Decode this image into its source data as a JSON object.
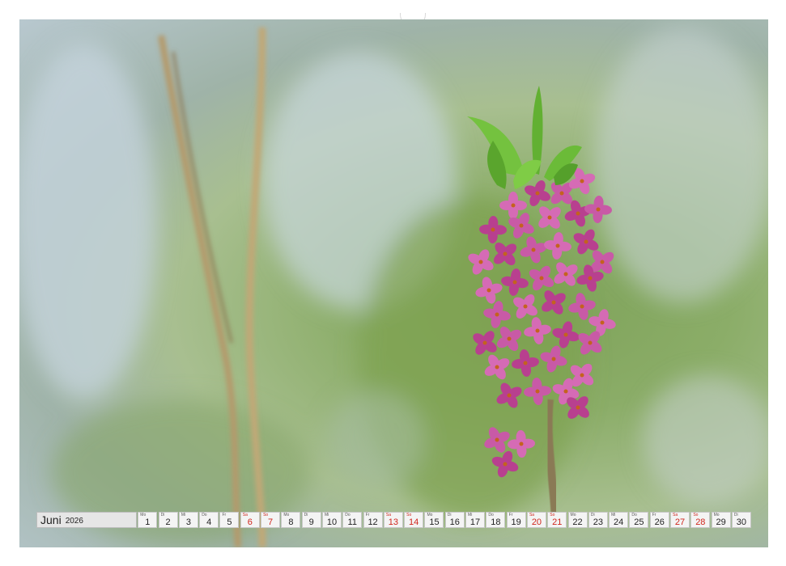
{
  "calendar": {
    "month": "Juni",
    "year": "2026",
    "days": [
      {
        "dow": "Mo",
        "num": "1",
        "weekend": false
      },
      {
        "dow": "Di",
        "num": "2",
        "weekend": false
      },
      {
        "dow": "Mi",
        "num": "3",
        "weekend": false
      },
      {
        "dow": "Do",
        "num": "4",
        "weekend": false
      },
      {
        "dow": "Fr",
        "num": "5",
        "weekend": false
      },
      {
        "dow": "Sa",
        "num": "6",
        "weekend": true
      },
      {
        "dow": "So",
        "num": "7",
        "weekend": true
      },
      {
        "dow": "Mo",
        "num": "8",
        "weekend": false
      },
      {
        "dow": "Di",
        "num": "9",
        "weekend": false
      },
      {
        "dow": "Mi",
        "num": "10",
        "weekend": false
      },
      {
        "dow": "Do",
        "num": "11",
        "weekend": false
      },
      {
        "dow": "Fr",
        "num": "12",
        "weekend": false
      },
      {
        "dow": "Sa",
        "num": "13",
        "weekend": true
      },
      {
        "dow": "So",
        "num": "14",
        "weekend": true
      },
      {
        "dow": "Mo",
        "num": "15",
        "weekend": false
      },
      {
        "dow": "Di",
        "num": "16",
        "weekend": false
      },
      {
        "dow": "Mi",
        "num": "17",
        "weekend": false
      },
      {
        "dow": "Do",
        "num": "18",
        "weekend": false
      },
      {
        "dow": "Fr",
        "num": "19",
        "weekend": false
      },
      {
        "dow": "Sa",
        "num": "20",
        "weekend": true
      },
      {
        "dow": "So",
        "num": "21",
        "weekend": true
      },
      {
        "dow": "Mo",
        "num": "22",
        "weekend": false
      },
      {
        "dow": "Di",
        "num": "23",
        "weekend": false
      },
      {
        "dow": "Mi",
        "num": "24",
        "weekend": false
      },
      {
        "dow": "Do",
        "num": "25",
        "weekend": false
      },
      {
        "dow": "Fr",
        "num": "26",
        "weekend": false
      },
      {
        "dow": "Sa",
        "num": "27",
        "weekend": true
      },
      {
        "dow": "So",
        "num": "28",
        "weekend": true
      },
      {
        "dow": "Mo",
        "num": "29",
        "weekend": false
      },
      {
        "dow": "Di",
        "num": "30",
        "weekend": false
      }
    ]
  },
  "colors": {
    "weekend": "#d0251c",
    "blossom": "#c0479a",
    "leaf": "#6fbf3a",
    "background": "#8bad68"
  }
}
